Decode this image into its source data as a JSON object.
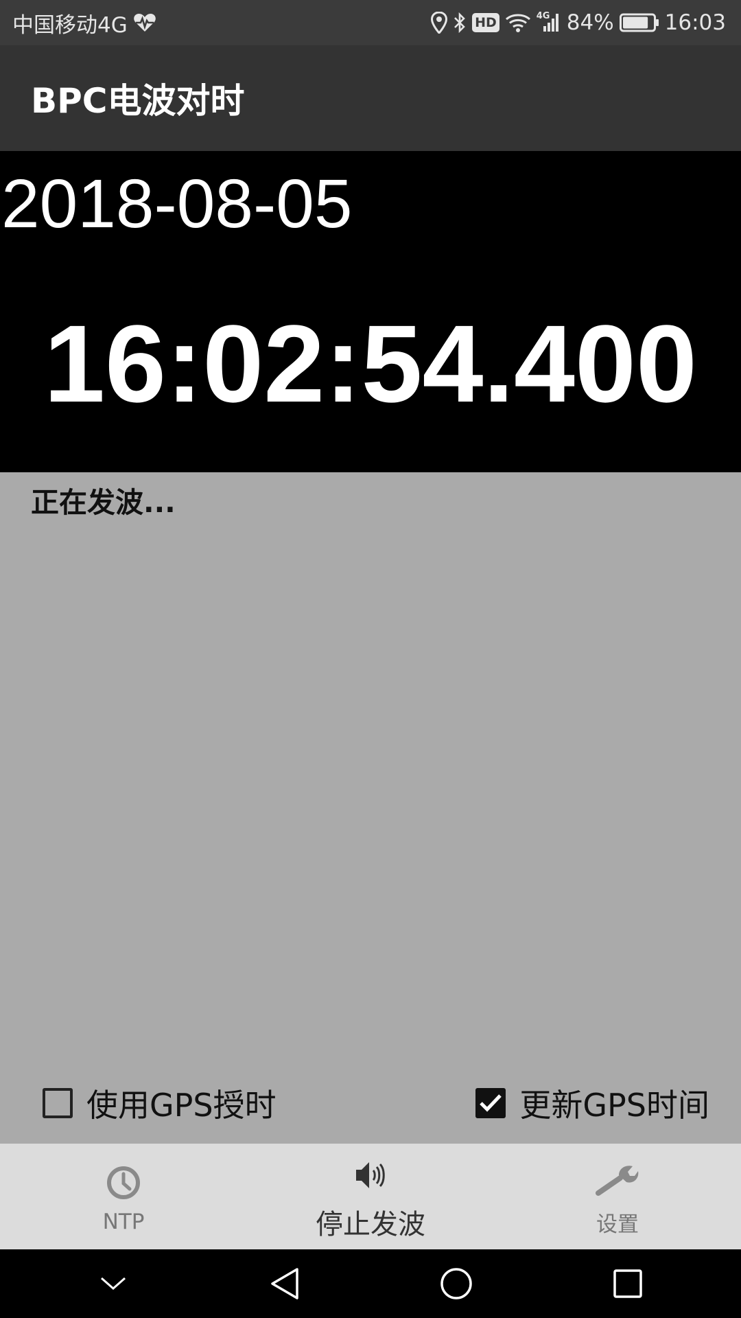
{
  "status_bar": {
    "carrier": "中国移动4G",
    "hd_label": "HD",
    "network_type": "4G",
    "battery_percent": "84%",
    "clock": "16:03",
    "battery_level": 0.84,
    "icons": [
      "heartbeat-icon",
      "location-icon",
      "bluetooth-icon",
      "hd-icon",
      "wifi-icon",
      "signal-icon",
      "battery-icon"
    ]
  },
  "app_bar": {
    "title": "BPC电波对时"
  },
  "clock": {
    "date": "2018-08-05",
    "time": "16:02:54.400"
  },
  "content": {
    "status_message": "正在发波...",
    "options": [
      {
        "label": "使用GPS授时",
        "checked": false
      },
      {
        "label": "更新GPS时间",
        "checked": true
      }
    ]
  },
  "tabs": [
    {
      "label": "NTP",
      "icon": "clock-icon",
      "active": false
    },
    {
      "label": "停止发波",
      "icon": "speaker-icon",
      "active": true
    },
    {
      "label": "设置",
      "icon": "wrench-icon",
      "active": false
    }
  ],
  "nav_bar": {
    "buttons": [
      "collapse-icon",
      "back-icon",
      "home-icon",
      "recents-icon"
    ]
  },
  "colors": {
    "status_bar_bg": "#3b3b3b",
    "app_bar_bg": "#333333",
    "clock_bg": "#000000",
    "content_bg": "#aaaaaa",
    "tab_bar_bg": "#dcdcdc"
  }
}
